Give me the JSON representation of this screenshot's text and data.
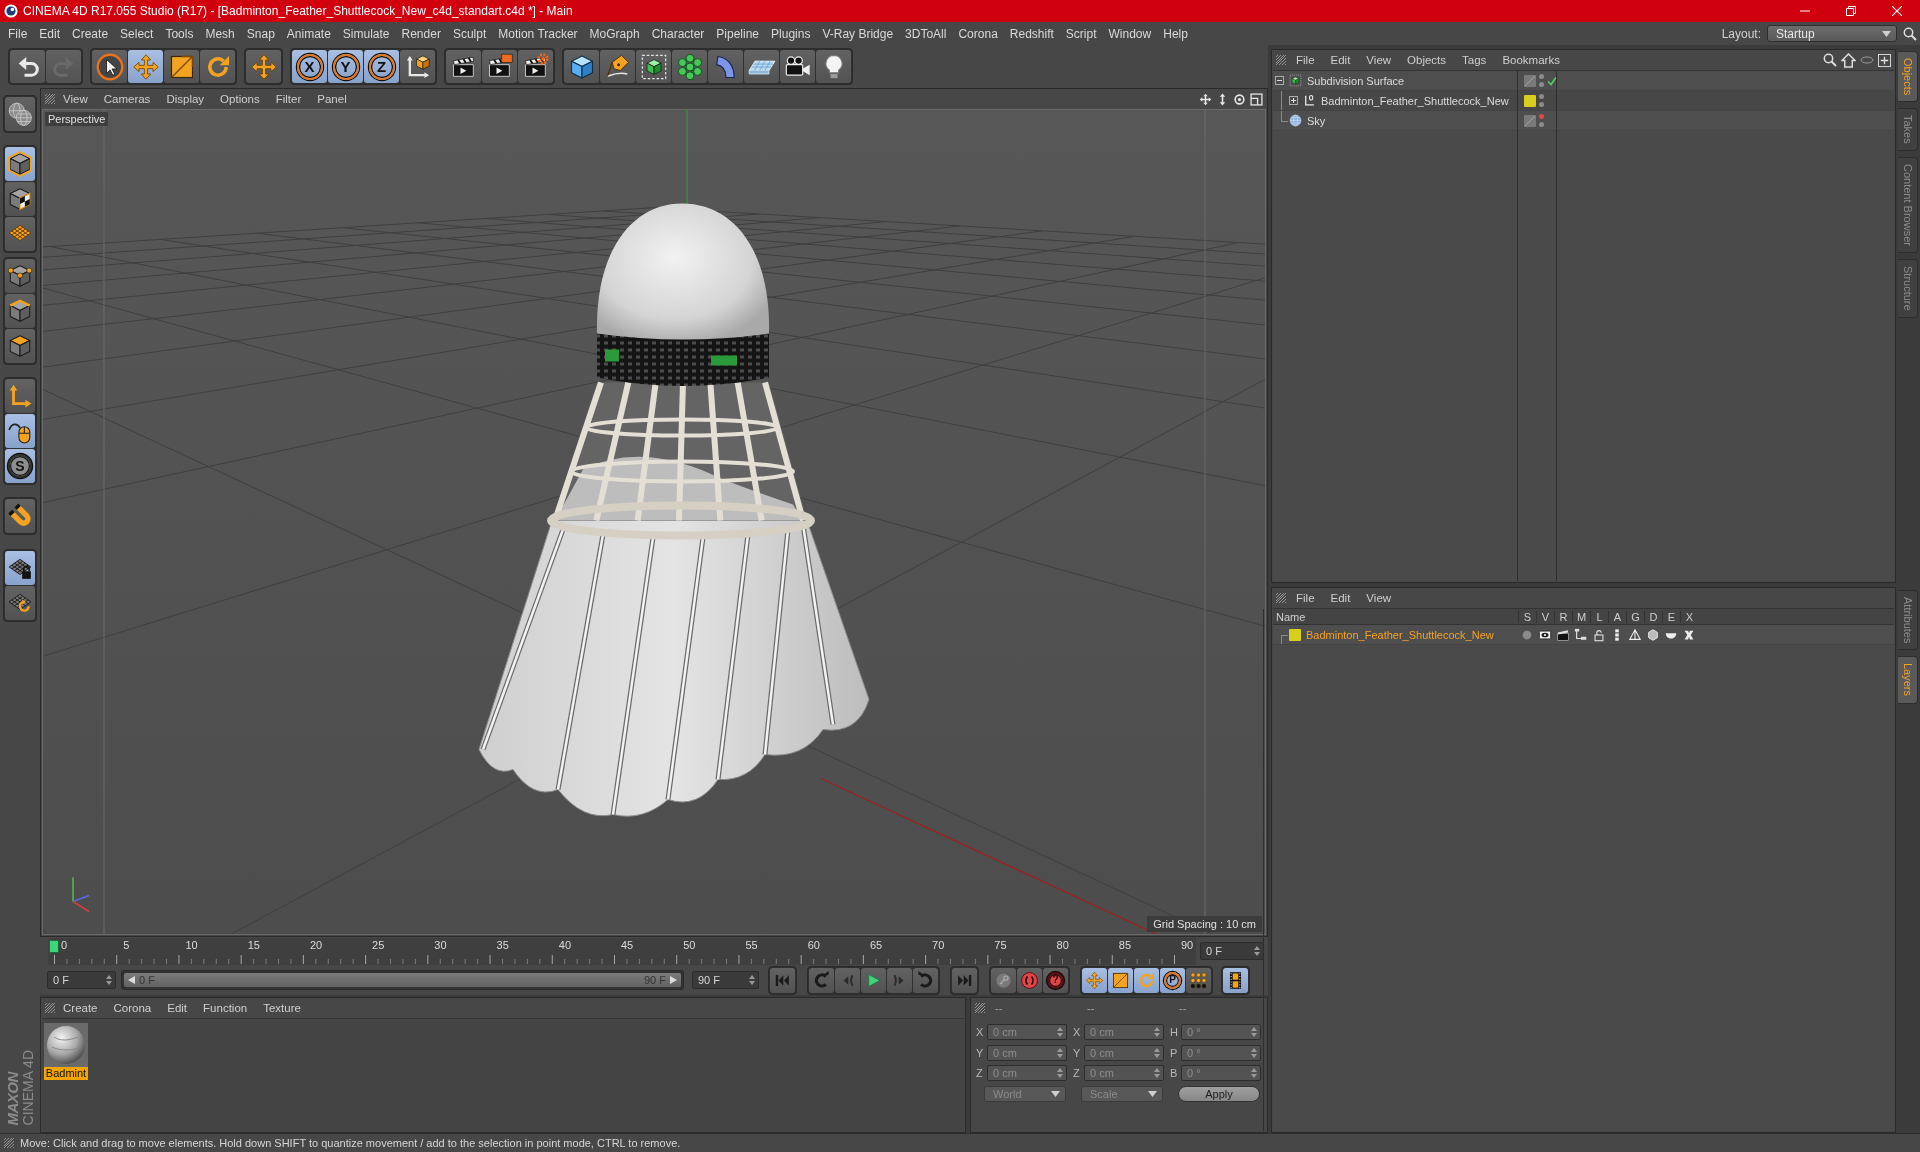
{
  "window": {
    "title": "CINEMA 4D R17.055 Studio (R17) - [Badminton_Feather_Shuttlecock_New_c4d_standart.c4d *] - Main"
  },
  "menu": [
    "File",
    "Edit",
    "Create",
    "Select",
    "Tools",
    "Mesh",
    "Snap",
    "Animate",
    "Simulate",
    "Render",
    "Sculpt",
    "Motion Tracker",
    "MoGraph",
    "Character",
    "Pipeline",
    "Plugins",
    "V-Ray Bridge",
    "3DToAll",
    "Corona",
    "Redshift",
    "Script",
    "Window",
    "Help"
  ],
  "layout": {
    "label": "Layout:",
    "value": "Startup"
  },
  "toolbar": [
    {
      "buttons": [
        {
          "kind": "undo",
          "selected": false,
          "disabled": false
        },
        {
          "kind": "redo",
          "selected": false,
          "disabled": true
        }
      ]
    },
    {
      "buttons": [
        {
          "kind": "live-select",
          "selected": false
        },
        {
          "kind": "move",
          "selected": true
        },
        {
          "kind": "scale",
          "selected": false
        },
        {
          "kind": "rotate",
          "selected": false
        }
      ]
    },
    {
      "buttons": [
        {
          "kind": "recent-tool",
          "selected": false
        }
      ]
    },
    {
      "buttons": [
        {
          "kind": "axis",
          "label": "X",
          "selected": true
        },
        {
          "kind": "axis",
          "label": "Y",
          "selected": true
        },
        {
          "kind": "axis",
          "label": "Z",
          "selected": true
        },
        {
          "kind": "coordinate-system",
          "selected": false
        }
      ]
    },
    {
      "buttons": [
        {
          "kind": "render-view",
          "selected": false
        },
        {
          "kind": "render-picture",
          "selected": false
        },
        {
          "kind": "render-settings",
          "selected": false
        }
      ]
    },
    {
      "buttons": [
        {
          "kind": "cube",
          "selected": false
        },
        {
          "kind": "pen",
          "selected": false
        },
        {
          "kind": "subdivision",
          "selected": false
        },
        {
          "kind": "cloner",
          "selected": false
        },
        {
          "kind": "bend",
          "selected": false
        },
        {
          "kind": "floor",
          "selected": false
        },
        {
          "kind": "camera",
          "selected": false
        },
        {
          "kind": "light",
          "selected": false
        }
      ]
    }
  ],
  "left_toolbar": [
    {
      "buttons": [
        {
          "kind": "make-editable",
          "selected": false
        }
      ]
    },
    {
      "buttons": [
        {
          "kind": "model",
          "selected": true
        },
        {
          "kind": "texture",
          "selected": false
        },
        {
          "kind": "workplane",
          "selected": false
        }
      ]
    },
    {
      "buttons": [
        {
          "kind": "points",
          "selected": false
        },
        {
          "kind": "edges",
          "selected": false
        },
        {
          "kind": "polygons",
          "selected": false
        }
      ]
    },
    {
      "buttons": [
        {
          "kind": "axis-mode",
          "selected": false
        },
        {
          "kind": "tweak",
          "selected": true
        },
        {
          "kind": "solo",
          "label": "S",
          "selected": true
        }
      ]
    },
    {
      "buttons": [
        {
          "kind": "snap",
          "selected": false
        }
      ]
    },
    {
      "buttons": [
        {
          "kind": "workplane-lock",
          "selected": true
        },
        {
          "kind": "workplane-align",
          "selected": false
        }
      ]
    }
  ],
  "logo": {
    "brand": "MAXON",
    "product": "CINEMA 4D"
  },
  "viewport": {
    "menu": [
      "View",
      "Cameras",
      "Display",
      "Options",
      "Filter",
      "Panel"
    ],
    "camera": "Perspective",
    "grid_spacing": "Grid Spacing : 10 cm"
  },
  "timeline": {
    "ticks": [
      "0",
      "5",
      "10",
      "15",
      "20",
      "25",
      "30",
      "35",
      "40",
      "45",
      "50",
      "55",
      "60",
      "65",
      "70",
      "75",
      "80",
      "85",
      "90"
    ],
    "level": 0,
    "current_frame": "0 F",
    "start": "0 F",
    "range": {
      "start": "0 F",
      "end": "90 F",
      "level": 1
    },
    "end": "90 F"
  },
  "transport": [
    {
      "buttons": [
        {
          "kind": "goto-start",
          "selected": false
        }
      ]
    },
    {
      "buttons": [
        {
          "kind": "prev-key",
          "selected": false
        },
        {
          "kind": "prev-frame",
          "selected": false
        },
        {
          "kind": "play",
          "selected": false
        },
        {
          "kind": "next-frame",
          "selected": false
        },
        {
          "kind": "next-key",
          "selected": false
        }
      ]
    },
    {
      "buttons": [
        {
          "kind": "goto-end",
          "selected": false
        }
      ]
    },
    {
      "buttons": [
        {
          "kind": "record-key",
          "selected": false
        },
        {
          "kind": "autokey",
          "selected": false
        },
        {
          "kind": "keyframe-selection",
          "label": "?",
          "selected": false
        }
      ]
    },
    {
      "buttons": [
        {
          "kind": "key-position",
          "selected": true
        },
        {
          "kind": "key-scale",
          "selected": true
        },
        {
          "kind": "key-rotation",
          "selected": true
        },
        {
          "kind": "key-parameter",
          "label": "P",
          "selected": true
        },
        {
          "kind": "key-points",
          "selected": false
        }
      ]
    },
    {
      "buttons": [
        {
          "kind": "timeline",
          "selected": true
        }
      ]
    }
  ],
  "materials": {
    "menu": [
      "Create",
      "Corona",
      "Edit",
      "Function",
      "Texture"
    ],
    "items": [
      {
        "name": "Badmint",
        "selected": true
      }
    ]
  },
  "coordinates": {
    "headers": [
      "--",
      "--",
      "--"
    ],
    "disabled": true,
    "rows": [
      {
        "cells": [
          {
            "label": "X",
            "value": "0 cm"
          },
          {
            "label": "X",
            "value": "0 cm"
          },
          {
            "label": "H",
            "value": "0 °"
          }
        ]
      },
      {
        "cells": [
          {
            "label": "Y",
            "value": "0 cm"
          },
          {
            "label": "Y",
            "value": "0 cm"
          },
          {
            "label": "P",
            "value": "0 °"
          }
        ]
      },
      {
        "cells": [
          {
            "label": "Z",
            "value": "0 cm"
          },
          {
            "label": "Z",
            "value": "0 cm"
          },
          {
            "label": "B",
            "value": "0 °"
          }
        ]
      }
    ],
    "mode": "World",
    "size_mode": "Scale",
    "apply": "Apply"
  },
  "objects": {
    "menu": [
      "File",
      "Edit",
      "View",
      "Objects",
      "Tags",
      "Bookmarks"
    ],
    "tree": [
      {
        "name": "Subdivision Surface",
        "kind": "subdivision",
        "expanded": true,
        "editor_visible": true,
        "render_visible": true,
        "enabled": true,
        "children": [
          {
            "name": "Badminton_Feather_Shuttlecock_New",
            "kind": "null",
            "expanded": false,
            "color": "#d8cf1d",
            "editor_visible": true,
            "render_visible": true
          }
        ]
      },
      {
        "name": "Sky",
        "kind": "sky",
        "editor_visible": false,
        "render_visible": true
      }
    ]
  },
  "layers": {
    "menu": [
      "File",
      "Edit",
      "View"
    ],
    "columns": [
      "Name",
      "S",
      "V",
      "R",
      "M",
      "L",
      "A",
      "G",
      "D",
      "E",
      "X"
    ],
    "rows": [
      {
        "name": "Badminton_Feather_Shuttlecock_New",
        "color": "#d8cf1d",
        "selected": true,
        "solo": false,
        "locked": false
      }
    ]
  },
  "side_tabs": {
    "top": [
      {
        "label": "Objects",
        "selected": true
      },
      {
        "label": "Takes",
        "selected": false
      },
      {
        "label": "Content Browser",
        "selected": false
      },
      {
        "label": "Structure",
        "selected": false
      }
    ],
    "bottom": [
      {
        "label": "Attributes",
        "selected": false
      },
      {
        "label": "Layers",
        "selected": true
      }
    ]
  },
  "status": "Move: Click and drag to move elements. Hold down SHIFT to quantize movement / add to the selection in point mode, CTRL to remove."
}
